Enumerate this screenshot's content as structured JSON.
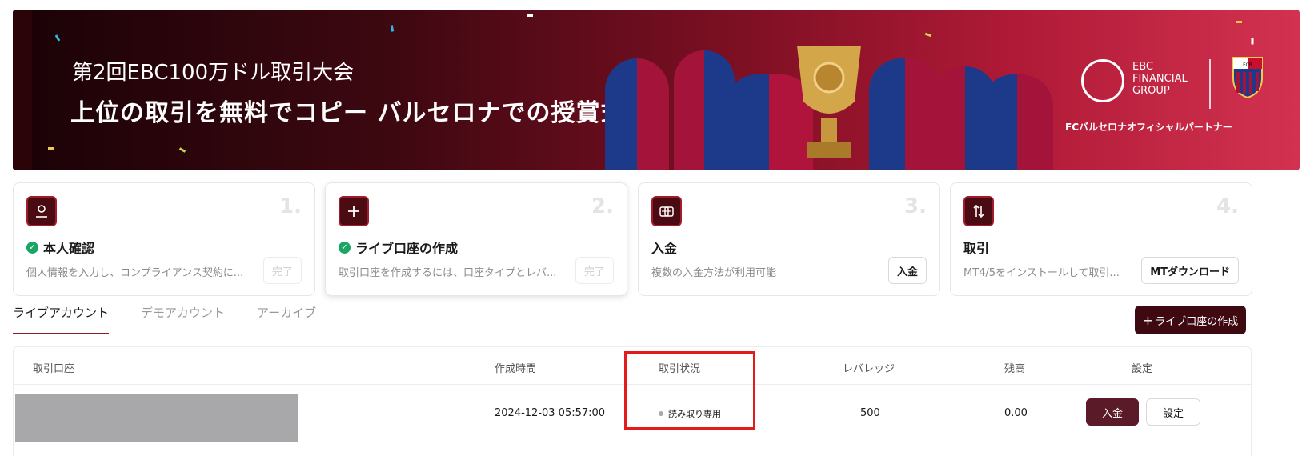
{
  "banner": {
    "title_line1": "第2回EBC100万ドル取引大会",
    "title_line2": "上位の取引を無料でコピー バルセロナでの授賞式",
    "brand_text": "EBC\nFINANCIAL\nGROUP",
    "partner_text": "FCバルセロナオフィシャルパートナー",
    "crest_text": "FCB"
  },
  "steps": [
    {
      "number": "1.",
      "icon": "user-icon",
      "title": "本人確認",
      "completed": true,
      "desc": "個人情報を入力し、コンプライアンス契約に...",
      "button": "完了"
    },
    {
      "number": "2.",
      "icon": "plus-icon",
      "title": "ライブ口座の作成",
      "completed": true,
      "desc": "取引口座を作成するには、口座タイプとレバ...",
      "button": "完了"
    },
    {
      "number": "3.",
      "icon": "coins-icon",
      "title": "入金",
      "completed": false,
      "desc": "複数の入金方法が利用可能",
      "button": "入金"
    },
    {
      "number": "4.",
      "icon": "swap-arrows-icon",
      "title": "取引",
      "completed": false,
      "desc": "MT4/5をインストールして取引...",
      "button": "MTダウンロード"
    }
  ],
  "tabs": [
    {
      "label": "ライブアカウント",
      "active": true
    },
    {
      "label": "デモアカウント",
      "active": false
    },
    {
      "label": "アーカイブ",
      "active": false
    }
  ],
  "create_button": "ライブ口座の作成",
  "table": {
    "headers": [
      "取引口座",
      "作成時間",
      "取引状況",
      "レバレッジ",
      "残高",
      "設定"
    ],
    "rows": [
      {
        "account": "",
        "created": "2024-12-03 05:57:00",
        "status": "読み取り専用",
        "leverage": "500",
        "balance": "0.00",
        "deposit_btn": "入金",
        "settings_btn": "設定"
      }
    ]
  },
  "colors": {
    "brand_dark": "#3e0910",
    "accent": "#8a1e2a",
    "success": "#1aa564",
    "highlight": "#e31b1b"
  }
}
